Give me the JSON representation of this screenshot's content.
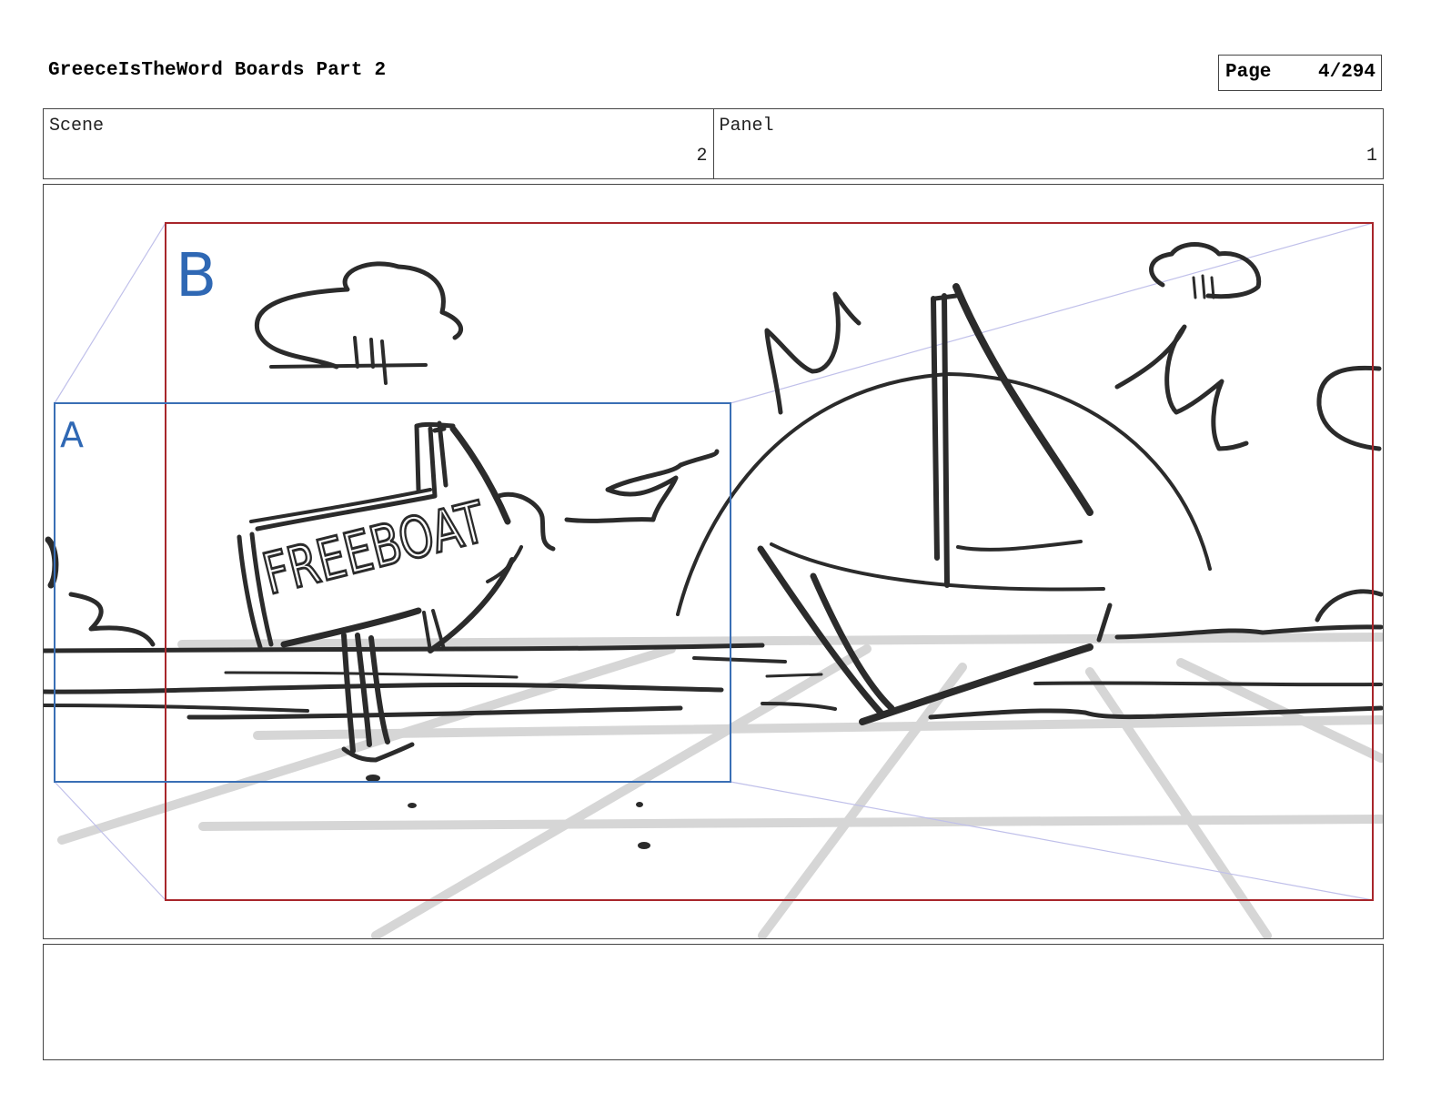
{
  "header": {
    "title": "GreeceIsTheWord Boards Part 2",
    "page_label": "Page",
    "page_number": "4/294"
  },
  "info": {
    "scene_label": "Scene",
    "scene_value": "2",
    "panel_label": "Panel",
    "panel_value": "1"
  },
  "panel": {
    "frame_a_label": "A",
    "frame_b_label": "B",
    "sign_text": "FREEBOAT",
    "colors": {
      "frame_a": "#3a6fb5",
      "frame_b": "#a8262b",
      "guide": "#b8b8e6",
      "ink": "#2b2b2b",
      "grid": "#d6d6d6"
    }
  },
  "notes": {
    "text": ""
  }
}
